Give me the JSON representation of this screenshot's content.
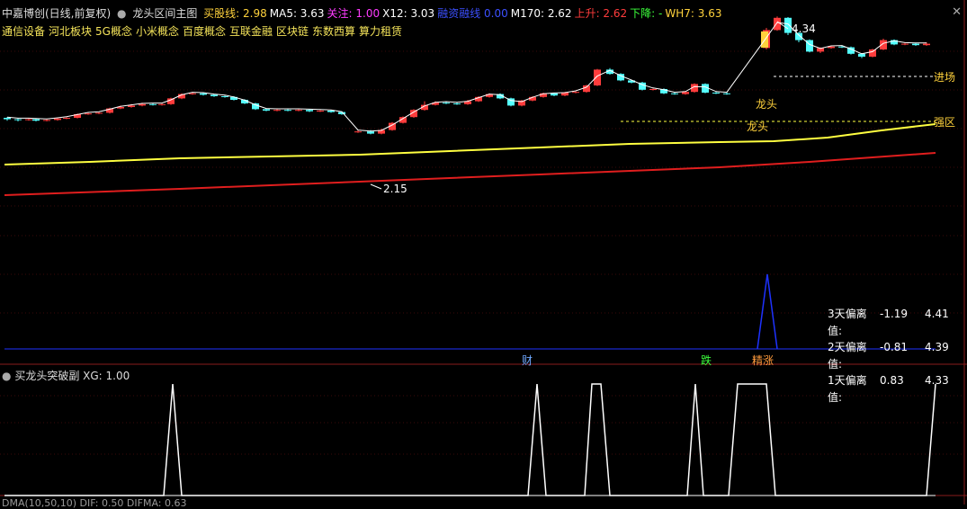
{
  "header": {
    "stock_name": "中嘉博创(日线,前复权)",
    "indicator_name": "龙头区间主图",
    "items": [
      {
        "label": "买股线:",
        "value": "2.98",
        "color": "#ffd23c"
      },
      {
        "label": "MA5:",
        "value": "3.63",
        "color": "#ffffff"
      },
      {
        "label": "关注:",
        "value": "1.00",
        "color": "#ff3cff"
      },
      {
        "label": "X12:",
        "value": "3.03",
        "color": "#ffffff"
      },
      {
        "label": "融资融线",
        "value": "0.00",
        "color": "#3c50ff"
      },
      {
        "label": "M170:",
        "value": "2.62",
        "color": "#ffffff"
      },
      {
        "label": "上升:",
        "value": "2.62",
        "color": "#ff3c3c"
      },
      {
        "label": "下降:",
        "value": "-",
        "color": "#3cff3c"
      },
      {
        "label": "WH7:",
        "value": "3.63",
        "color": "#ffd23c"
      }
    ]
  },
  "concepts": [
    "通信设备",
    "河北板块",
    "5G概念",
    "小米概念",
    "百度概念",
    "互联金融",
    "区块链",
    "东数西算",
    "算力租赁"
  ],
  "annotations": {
    "high": "4.34",
    "low": "2.15",
    "dragon_head_1": "龙头",
    "dragon_head_2": "龙头",
    "enter": "进场",
    "strong": "强区"
  },
  "deviation": [
    {
      "label": "3天偏离值:",
      "value": "-1.19",
      "price": "4.41"
    },
    {
      "label": "2天偏离值:",
      "value": "-0.81",
      "price": "4.39"
    },
    {
      "label": "1天偏离值:",
      "value": "0.83",
      "price": "4.33"
    }
  ],
  "markers": {
    "cai": "财",
    "die": "跌",
    "jingzhang": "精涨"
  },
  "sub_panel": {
    "title": "买龙头突破副",
    "xg_label": "XG:",
    "xg_value": "1.00"
  },
  "bottom_panel": {
    "text": "DMA(10,50,10)  DIF: 0.50  DIFMA: 0.63"
  },
  "colors": {
    "up": "#ff3c3c",
    "down": "#54ffff",
    "yellow": "#ffff40",
    "red_line": "#e01e1e",
    "blue": "#1e32ff"
  }
}
